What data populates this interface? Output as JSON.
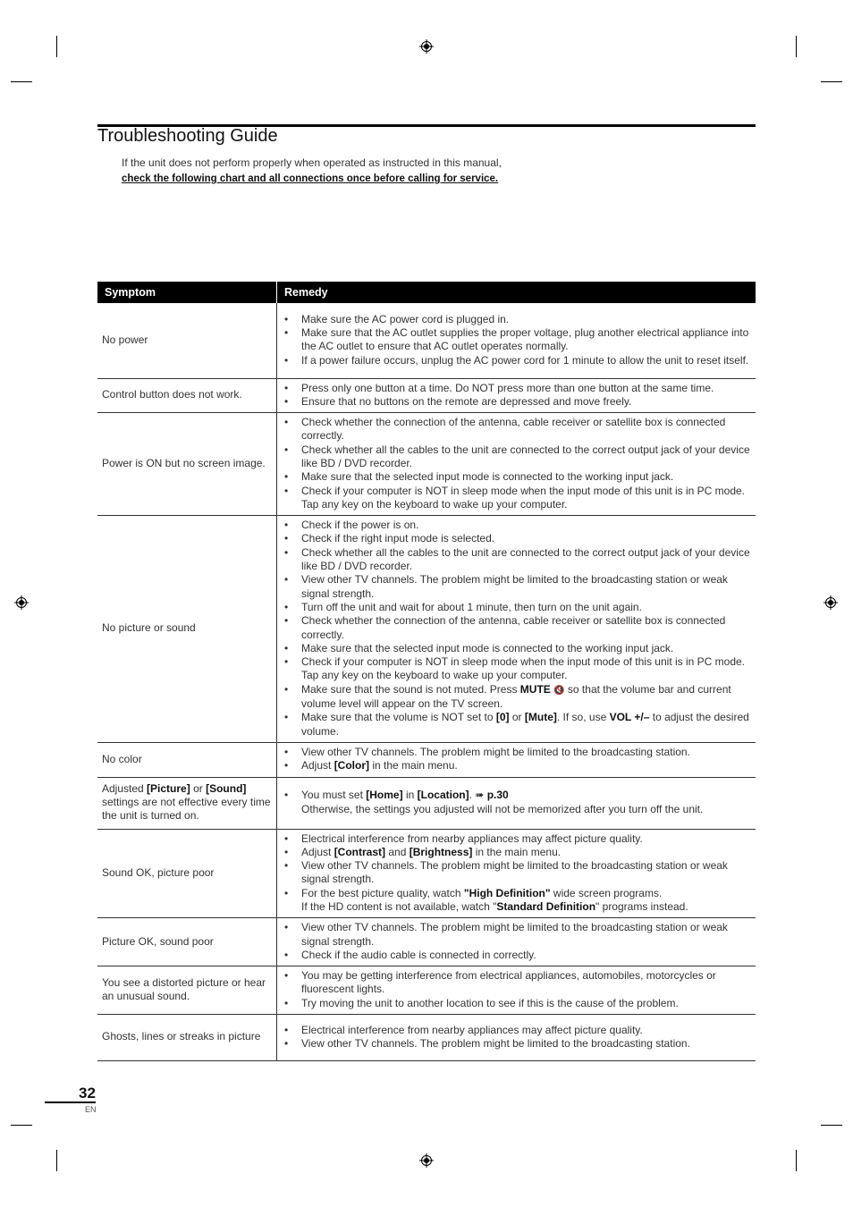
{
  "page": {
    "title": "Troubleshooting Guide",
    "intro_line1": "If the unit does not perform properly when operated as instructed in this manual,",
    "intro_line2": "check the following chart and all connections once before calling for service.",
    "page_number": "32",
    "language": "EN",
    "icons": {
      "registration_mark": "crosshair-registration-icon",
      "page_ref": "arrow-right-icon",
      "mute": "speaker-mute-icon"
    }
  },
  "table": {
    "headers": {
      "symptom": "Symptom",
      "remedy": "Remedy"
    },
    "rows": [
      {
        "symptom": "No power",
        "remedies": [
          "Make sure the AC power cord is plugged in.",
          "Make sure that the AC outlet supplies the proper voltage, plug another electrical appliance into the AC outlet to ensure that AC outlet operates normally.",
          "If a power failure occurs, unplug the AC power cord for 1 minute to allow the unit to reset itself."
        ]
      },
      {
        "symptom": "Control button does not work.",
        "remedies": [
          "Press only one button at a time. Do NOT press more than one button at the same time.",
          "Ensure that no buttons on the remote are depressed and move freely."
        ]
      },
      {
        "symptom": "Power is ON but no screen image.",
        "remedies": [
          "Check whether the connection of the antenna, cable receiver or satellite box is connected correctly.",
          "Check whether all the cables to the unit are connected to the correct output jack of your device like BD / DVD recorder.",
          "Make sure that the selected input mode is connected to the working input jack.",
          "Check if your computer is NOT in sleep mode when the input mode of this unit is in PC mode. Tap any key on the keyboard to wake up your computer."
        ]
      },
      {
        "symptom": "No picture or sound",
        "remedies": [
          "Check if the power is on.",
          "Check if the right input mode is selected.",
          "Check whether all the cables to the unit are connected to the correct output jack of your device like BD / DVD recorder.",
          "View other TV channels. The problem might be limited to the broadcasting station or weak signal strength.",
          "Turn off the unit and wait for about 1 minute, then turn on the unit again.",
          "Check whether the connection of the antenna, cable receiver or satellite box is connected correctly.",
          "Make sure that the selected input mode is connected to the working input jack.",
          "Check if your computer is NOT in sleep mode when the input mode of this unit is in PC mode. Tap any key on the keyboard to wake up your computer."
        ],
        "mute_item": {
          "before": "Make sure that the sound is not muted. Press ",
          "key": "MUTE",
          "icon": "🔇",
          "after": " so that the volume bar and current volume level will appear on the TV screen."
        },
        "volume_item": {
          "t1": "Make sure that the volume is NOT set to ",
          "k1": "[0]",
          "t2": " or ",
          "k2": "[Mute]",
          "t3": ". If so, use ",
          "k3": "VOL +/–",
          "t4": " to adjust the desired volume."
        }
      },
      {
        "symptom": "No color",
        "remedies": [
          "View other TV channels. The problem might be limited to the broadcasting station."
        ],
        "color_item": {
          "t1": "Adjust ",
          "k1": "[Color]",
          "t2": " in the main menu."
        }
      },
      {
        "symptom_parts": {
          "t1": "Adjusted ",
          "k1": "[Picture]",
          "t2": " or ",
          "k2": "[Sound]",
          "t3": " settings are not effective every time the unit is turned on."
        },
        "home_item": {
          "t1": "You must set ",
          "k1": "[Home]",
          "t2": " in ",
          "k2": "[Location]",
          "t3": ". ",
          "arrow": "➠",
          "ref": "p.30",
          "line2": "Otherwise, the settings you adjusted will not be memorized after you turn off the unit."
        }
      },
      {
        "symptom": "Sound OK, picture poor",
        "remedies": [
          "Electrical interference from nearby appliances may affect picture quality."
        ],
        "contrast_item": {
          "t1": "Adjust ",
          "k1": "[Contrast]",
          "t2": " and ",
          "k2": "[Brightness]",
          "t3": " in the main menu."
        },
        "remedies_mid": [
          "View other TV channels. The problem might be limited to the broadcasting station or weak signal strength."
        ],
        "hd_item": {
          "t1": "For the best picture quality, watch ",
          "k1": "\"High Definition\"",
          "t2": " wide screen programs.",
          "t3": "If the HD content is not available, watch \"",
          "k2": "Standard Definition",
          "t4": "\" programs instead."
        }
      },
      {
        "symptom": "Picture OK, sound poor",
        "remedies": [
          "View other TV channels. The problem might be limited to the broadcasting station or weak signal strength.",
          "Check if the audio cable is connected in correctly."
        ]
      },
      {
        "symptom": "You see a distorted picture or hear an unusual sound.",
        "remedies": [
          "You may be getting interference from electrical appliances, automobiles, motorcycles or fluorescent lights.",
          "Try moving the unit to another location to see if this is the cause of the problem."
        ]
      },
      {
        "symptom": "Ghosts, lines or streaks in picture",
        "remedies": [
          "Electrical interference from nearby appliances may affect picture quality.",
          "View other TV channels. The problem might be limited to the broadcasting station."
        ]
      }
    ]
  }
}
